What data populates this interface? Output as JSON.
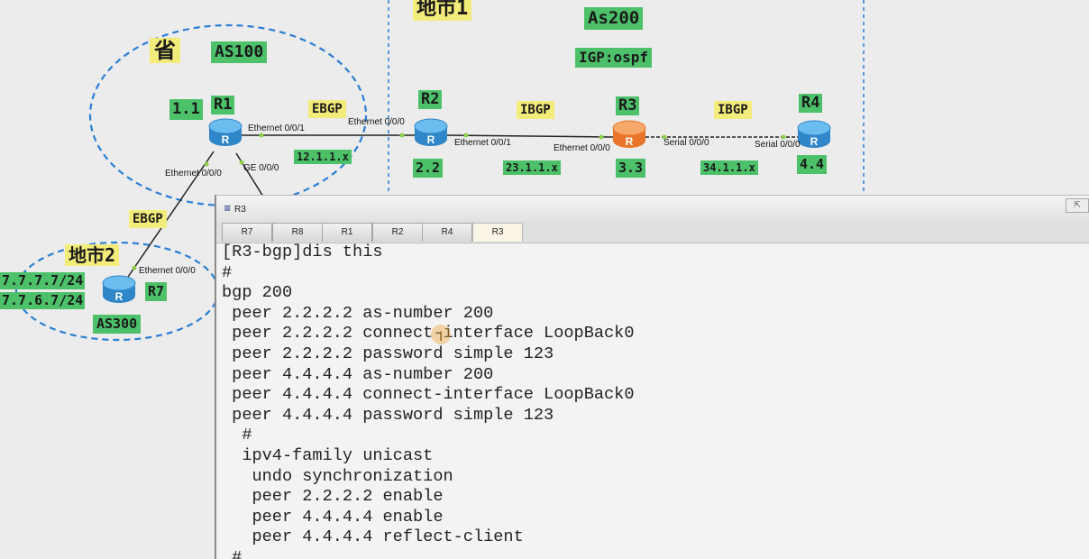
{
  "topology": {
    "regions": {
      "province": "省",
      "city1": "地市1",
      "city2": "地市2",
      "as100": "AS100",
      "as200": "As200",
      "as300": "AS300",
      "igp": "IGP:ospf"
    },
    "routers": {
      "r1": {
        "name": "R1",
        "id": "1.1"
      },
      "r2": {
        "name": "R2",
        "id": "2.2"
      },
      "r3": {
        "name": "R3",
        "id": "3.3"
      },
      "r4": {
        "name": "R4",
        "id": "4.4"
      },
      "r7": {
        "name": "R7",
        "networks": [
          "7.7.7.7/24",
          "7.7.6.7/24"
        ]
      }
    },
    "links": {
      "r1_r2": {
        "protocol": "EBGP",
        "subnet": "12.1.1.x",
        "port_a": "Ethernet 0/0/1",
        "port_b": "Ethernet 0/0/0"
      },
      "r2_r3": {
        "protocol": "IBGP",
        "subnet": "23.1.1.x",
        "port_a": "Ethernet 0/0/1",
        "port_b": "Ethernet 0/0/0"
      },
      "r3_r4": {
        "protocol": "IBGP",
        "subnet": "34.1.1.x",
        "port_a": "Serial 0/0/0",
        "port_b": "Serial 0/0/0"
      },
      "r1_r7": {
        "protocol": "EBGP",
        "port_a": "Ethernet 0/0/0",
        "port_b": "Ethernet 0/0/0"
      },
      "r1_down": {
        "port_a": "GE 0/0/0"
      }
    }
  },
  "terminal": {
    "title": "R3",
    "restore_icon": "restore-window-icon",
    "tabs": [
      "R7",
      "R8",
      "R1",
      "R2",
      "R4",
      "R3"
    ],
    "active_tab": "R3",
    "lines": [
      "[R3-bgp]dis this",
      "#",
      "bgp 200",
      " peer 2.2.2.2 as-number 200",
      " peer 2.2.2.2 connect-interface LoopBack0",
      " peer 2.2.2.2 password simple 123",
      " peer 4.4.4.4 as-number 200",
      " peer 4.4.4.4 connect-interface LoopBack0",
      " peer 4.4.4.4 password simple 123",
      "  #",
      "  ipv4-family unicast",
      "   undo synchronization",
      "   peer 2.2.2.2 enable",
      "   peer 4.4.4.4 enable",
      "   peer 4.4.4.4 reflect-client",
      " #"
    ]
  },
  "colors": {
    "router_blue": "#3b9bd9",
    "router_orange": "#f08a3c",
    "label_green": "#4cc16a",
    "label_yellow": "#f4ec7a",
    "dashed_blue": "#2a7fd4"
  }
}
